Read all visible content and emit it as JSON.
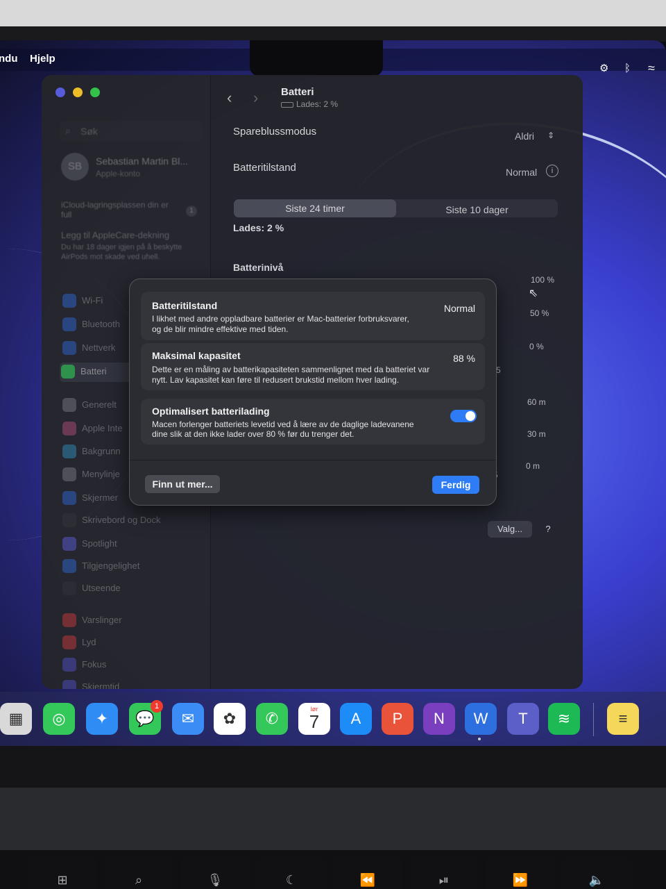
{
  "menubar": {
    "items": [
      "ndu",
      "Hjelp"
    ],
    "status_icons": [
      "settings-gear-icon",
      "bluetooth-icon",
      "wifi-icon"
    ]
  },
  "window": {
    "title": "Batteri",
    "subtitle": "Lades: 2 %",
    "search_placeholder": "Søk",
    "account": {
      "initials": "SB",
      "name": "Sebastian Martin Bl...",
      "sub": "Apple-konto"
    },
    "notes": [
      {
        "text": "iCloud-lagringsplassen din er full",
        "badge": "1"
      },
      {
        "text": "Legg til AppleCare-dekning",
        "detail": "Du har 18 dager igjen på å beskytte AirPods mot skade ved uhell."
      }
    ],
    "sidebar_items": [
      {
        "label": "Wi-Fi",
        "color": "#3478f6"
      },
      {
        "label": "Bluetooth",
        "color": "#3478f6"
      },
      {
        "label": "Nettverk",
        "color": "#3478f6"
      },
      {
        "label": "Batteri",
        "color": "#34c759",
        "active": true
      },
      {
        "label": "Generelt",
        "color": "#8e8e93"
      },
      {
        "label": "Apple Inte",
        "color": "#d25a8c"
      },
      {
        "label": "Bakgrunn",
        "color": "#35a7d8"
      },
      {
        "label": "Menylinje",
        "color": "#8e8e93"
      },
      {
        "label": "Skjermer",
        "color": "#3478f6"
      },
      {
        "label": "Skrivebord og Dock",
        "color": "#3a3a3c"
      },
      {
        "label": "Spotlight",
        "color": "#6a6aff"
      },
      {
        "label": "Tilgjengelighet",
        "color": "#3478f6"
      },
      {
        "label": "Utseende",
        "color": "#3a3a3c"
      },
      {
        "label": "Varslinger",
        "color": "#f04040"
      },
      {
        "label": "Lyd",
        "color": "#f04040"
      },
      {
        "label": "Fokus",
        "color": "#5e5ce6"
      },
      {
        "label": "Skjermtid",
        "color": "#5e5ce6"
      }
    ],
    "rows": {
      "low_power_label": "Sparebluss­modus",
      "low_power_value": "Aldri",
      "health_label": "Batteritilstand",
      "health_value": "Normal"
    },
    "tabs": [
      "Siste 24 timer",
      "Siste 10 dager"
    ],
    "charging_text": "Lades: 2 %",
    "battery_level_label": "Batterinivå",
    "chart_axis": {
      "level": [
        "100 %",
        "50 %",
        "0 %"
      ],
      "time": [
        "60 m",
        "30 m",
        "0 m"
      ],
      "cut_labels": [
        "5",
        "5"
      ]
    },
    "options_button": "Valg...",
    "help_button": "?"
  },
  "sheet": {
    "health": {
      "title": "Batteritilstand",
      "value": "Normal",
      "desc_line1": "I likhet med andre oppladbare batterier er Mac-batterier forbruksvarer,",
      "desc_line2": "og de blir mindre effektive med tiden."
    },
    "capacity": {
      "title": "Maksimal kapasitet",
      "value": "88 %",
      "desc_line1": "Dette er en måling av batterikapasiteten sammenlignet med da batteriet var",
      "desc_line2": "nytt. Lav kapasitet kan føre til redusert brukstid mellom hver lading."
    },
    "optimized": {
      "title": "Optimalisert batterilading",
      "enabled": true,
      "desc_line1": "Macen forlenger batteriets levetid ved å lære av de daglige ladevanene",
      "desc_line2": "dine slik at den ikke lader over 80 % før du trenger det."
    },
    "learn_more": "Finn ut mer...",
    "done": "Ferdig"
  },
  "dock": {
    "apps": [
      {
        "name": "calculator-icon",
        "glyph": "▦",
        "color": "#d9d9d9"
      },
      {
        "name": "find-my-icon",
        "glyph": "◎",
        "color": "#34c759"
      },
      {
        "name": "safari-icon",
        "glyph": "✦",
        "color": "#2f8cf5"
      },
      {
        "name": "messages-icon",
        "glyph": "💬",
        "color": "#34c759"
      },
      {
        "name": "mail-icon",
        "glyph": "✉",
        "color": "#3b8cf5"
      },
      {
        "name": "photos-icon",
        "glyph": "✿",
        "color": "#ffffff"
      },
      {
        "name": "phone-icon",
        "glyph": "✆",
        "color": "#34c759"
      },
      {
        "name": "calendar-icon",
        "glyph": "7",
        "color": "#ffffff"
      },
      {
        "name": "app-store-icon",
        "glyph": "A",
        "color": "#1d8cf6"
      },
      {
        "name": "powerpoint-icon",
        "glyph": "P",
        "color": "#e8533a"
      },
      {
        "name": "onenote-icon",
        "glyph": "N",
        "color": "#7a3fbf"
      },
      {
        "name": "word-icon",
        "glyph": "W",
        "color": "#2e6fe0"
      },
      {
        "name": "teams-icon",
        "glyph": "T",
        "color": "#5b5fc7"
      },
      {
        "name": "spotify-icon",
        "glyph": "≋",
        "color": "#1db954"
      },
      {
        "name": "notes-icon",
        "glyph": "≡",
        "color": "#f5d75a"
      }
    ],
    "messages_badge": "1",
    "calendar_month": "lør",
    "calendar_day": "7"
  },
  "keyboard": {
    "keys": [
      "mission-control-key",
      "search-key",
      "dictation-key",
      "focus-key",
      "rewind-key",
      "play-pause-key",
      "fast-forward-key",
      "mute-key"
    ]
  }
}
